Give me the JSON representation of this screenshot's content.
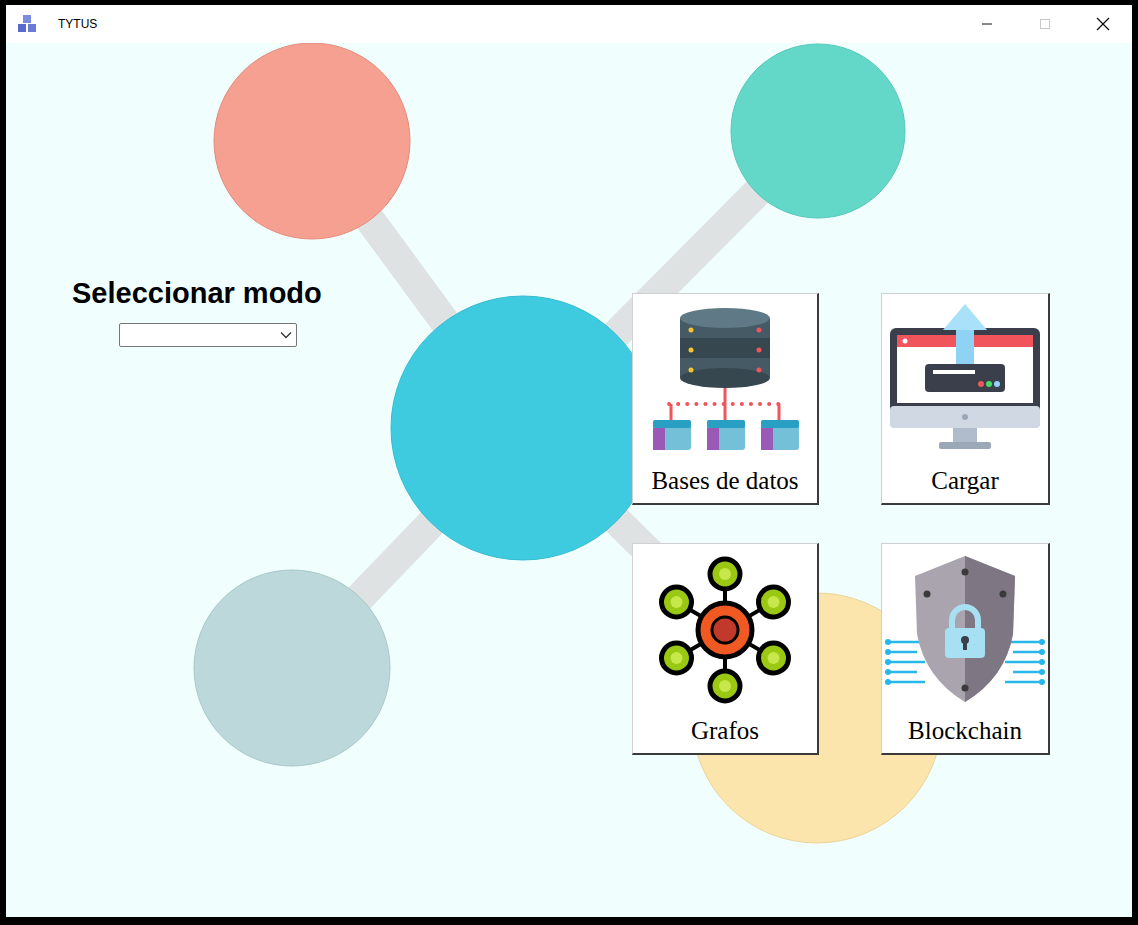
{
  "window": {
    "title": "TYTUS",
    "controls": [
      {
        "kind": "minimize",
        "disabled": false
      },
      {
        "kind": "maximize",
        "disabled": true
      },
      {
        "kind": "close",
        "disabled": false
      }
    ]
  },
  "mode_selector": {
    "label": "Seleccionar modo",
    "value": ""
  },
  "buttons": [
    {
      "label": "Bases de datos",
      "kind": "database"
    },
    {
      "label": "Cargar",
      "kind": "upload"
    },
    {
      "label": "Grafos",
      "kind": "graph"
    },
    {
      "label": "Blockchain",
      "kind": "blockchain"
    }
  ]
}
